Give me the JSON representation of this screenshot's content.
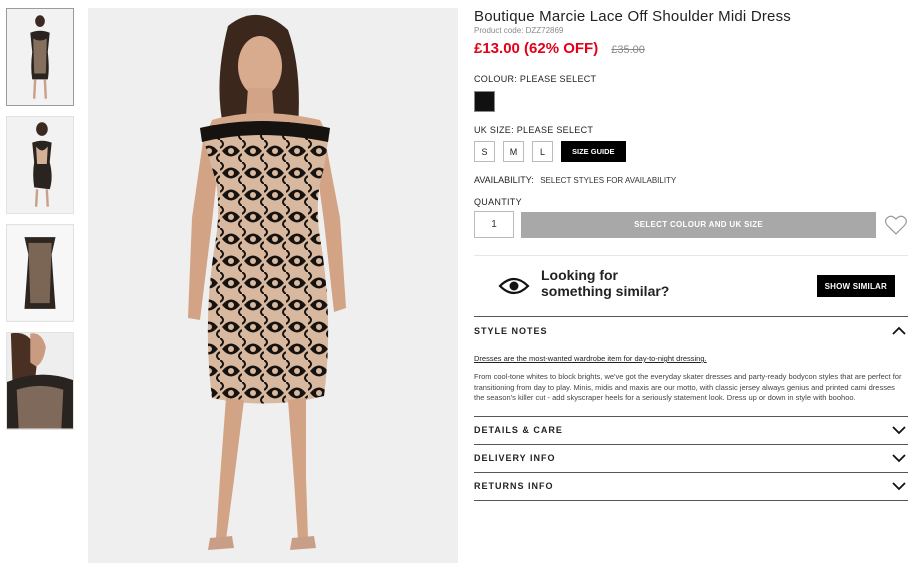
{
  "product": {
    "title": "Boutique Marcie Lace Off Shoulder Midi Dress",
    "code": "Product code: DZZ72869",
    "price": "£13.00 (62% OFF)",
    "was_price": "£35.00"
  },
  "colour": {
    "label": "COLOUR:",
    "value": "PLEASE SELECT",
    "swatch_color": "#111111"
  },
  "size": {
    "label": "UK SIZE:",
    "value": "PLEASE SELECT",
    "options": [
      "S",
      "M",
      "L"
    ],
    "guide": "SIZE GUIDE"
  },
  "availability": {
    "label": "AVAILABILITY:",
    "value": "SELECT STYLES FOR AVAILABILITY"
  },
  "quantity": {
    "label": "QUANTITY",
    "value": "1",
    "button": "SELECT COLOUR AND UK SIZE"
  },
  "similar": {
    "text_line1": "Looking for",
    "text_line2": "something similar?",
    "button": "SHOW SIMILAR"
  },
  "style_notes": {
    "title": "STYLE NOTES",
    "intro": "Dresses are the most-wanted wardrobe item for day-to-night dressing.",
    "body": "From cool-tone whites to block brights, we've got the everyday skater dresses and party-ready bodycon styles that are perfect for transitioning from day to play. Minis, midis and maxis are our motto, with classic jersey always genius and printed cami dresses the season's killer cut - add skyscraper heels for a seriously statement look. Dress up or down in style with boohoo."
  },
  "accordions": [
    "DETAILS & CARE",
    "DELIVERY INFO",
    "RETURNS INFO"
  ],
  "colors": {
    "sale_red": "#e2001a",
    "disabled_button": "#a8a8a8",
    "black": "#000000"
  }
}
